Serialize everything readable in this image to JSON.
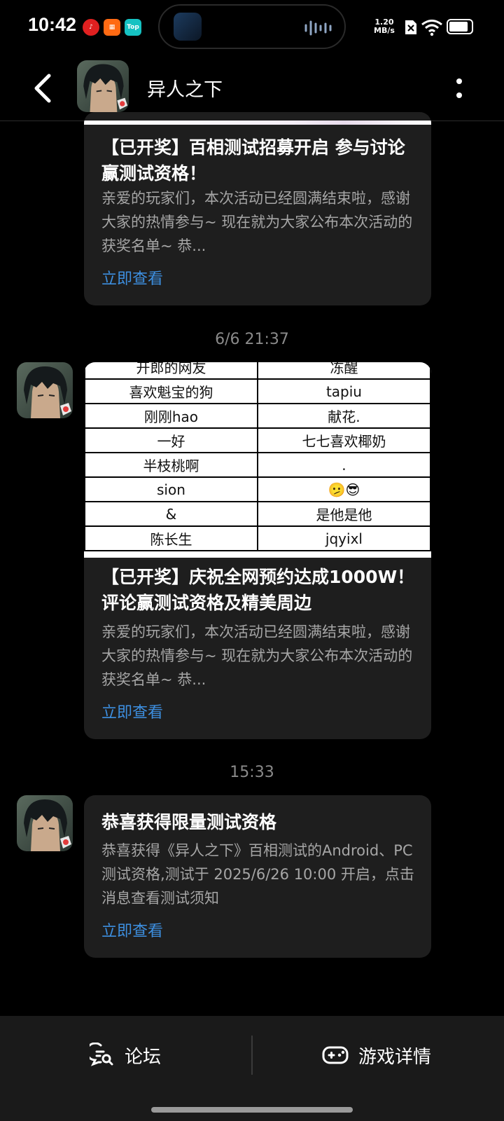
{
  "status_bar": {
    "time": "10:42",
    "net_speed_value": "1.20",
    "net_speed_unit": "MB/s",
    "battery_percent": 85
  },
  "header": {
    "title": "异人之下"
  },
  "messages": [
    {
      "title": "【已开奖】百相测试招募开启 参与讨论赢测试资格！",
      "body": "亲爱的玩家们，本次活动已经圆满结束啦，感谢大家的热情参与~ 现在就为大家公布本次活动的获奖名单~ 恭...",
      "link": "立即查看"
    },
    {
      "timestamp": "6/6  21:37",
      "table": [
        [
          "开郎的网友",
          "冻醒"
        ],
        [
          "喜欢魁宝的狗",
          "tapiu"
        ],
        [
          "刚刚hao",
          "献花."
        ],
        [
          "一好",
          "七七喜欢椰奶"
        ],
        [
          "半枝桃啊",
          "."
        ],
        [
          "sion",
          "🫤😎"
        ],
        [
          "&",
          "是他是他"
        ],
        [
          "陈长生",
          "jqyixl"
        ]
      ],
      "title": "【已开奖】庆祝全网预约达成1000W！评论赢测试资格及精美周边",
      "body": "亲爱的玩家们，本次活动已经圆满结束啦，感谢大家的热情参与~ 现在就为大家公布本次活动的获奖名单~ 恭...",
      "link": "立即查看"
    },
    {
      "timestamp": "15:33",
      "title": "恭喜获得限量测试资格",
      "body": "恭喜获得《异人之下》百相测试的Android、PC测试资格,测试于 2025/6/26 10:00 开启，点击消息查看测试须知",
      "link": "立即查看"
    }
  ],
  "bottom_bar": {
    "forum_label": "论坛",
    "game_details_label": "游戏详情"
  },
  "icons": {
    "app1": "netease-music-icon",
    "app2": "app-grid-icon",
    "app3": "top-icon",
    "back": "back-arrow-icon",
    "more": "more-vertical-icon",
    "forum": "chat-search-icon",
    "game": "gamepad-icon"
  },
  "colors": {
    "background": "#000000",
    "card": "#1e1e1e",
    "link": "#3d8fe0",
    "muted_text": "#a6a6a6",
    "timestamp": "#8a8a8a"
  }
}
